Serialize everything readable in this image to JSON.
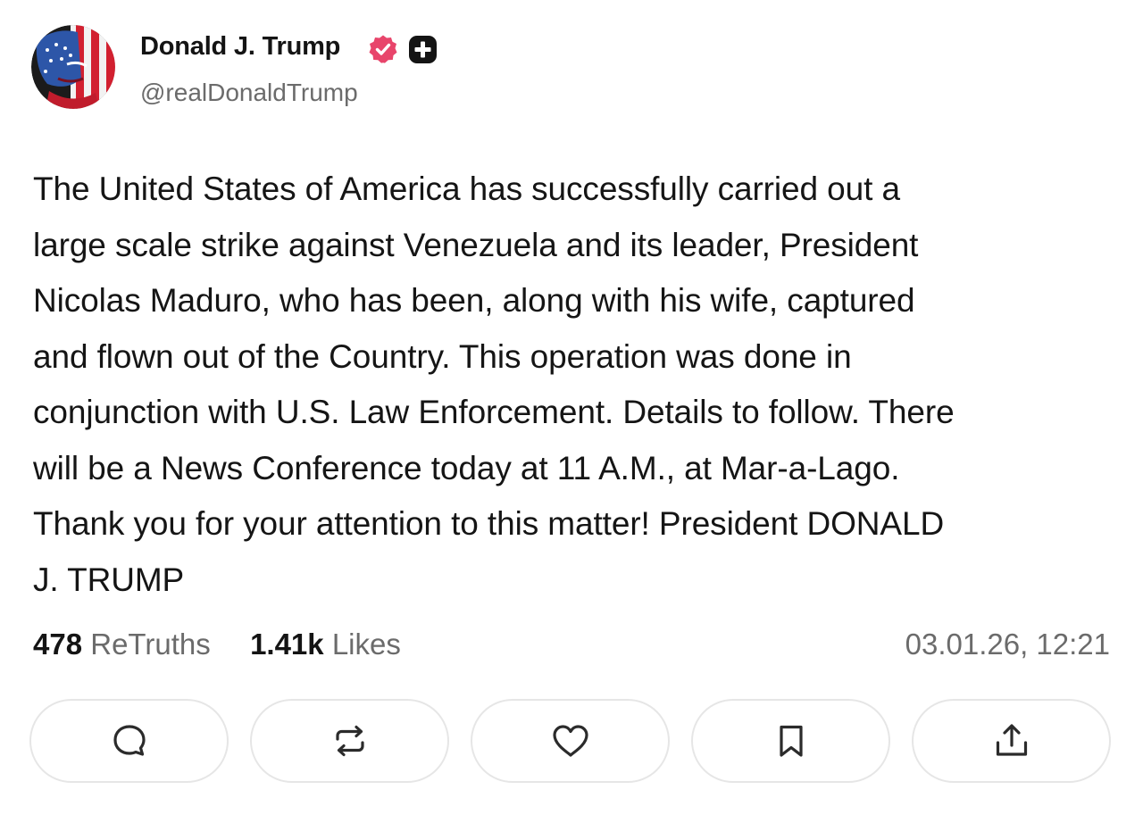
{
  "author": {
    "name": "Donald J. Trump",
    "handle": "@realDonaldTrump",
    "avatar_icon": "avatar-flag-portrait",
    "badges": [
      "verified-icon",
      "plus-badge-icon"
    ],
    "verified_color": "#e8456b"
  },
  "post": {
    "body": "The United States of America has successfully carried out a\nlarge scale strike against Venezuela and its leader, President\nNicolas Maduro, who has been, along with his wife, captured\nand flown out of the Country. This operation was done in\nconjunction with U.S. Law Enforcement. Details to follow. There\nwill be a News Conference today at 11 A.M., at Mar-a-Lago.\nThank you for your attention to this matter! President DONALD\nJ. TRUMP"
  },
  "stats": {
    "retruths_count": "478",
    "retruths_label": "ReTruths",
    "likes_count": "1.41k",
    "likes_label": "Likes",
    "timestamp": "03.01.26, 12:21"
  },
  "actions": [
    {
      "name": "reply",
      "icon": "comment-icon"
    },
    {
      "name": "retruth",
      "icon": "repost-icon"
    },
    {
      "name": "like",
      "icon": "heart-icon"
    },
    {
      "name": "bookmark",
      "icon": "bookmark-icon"
    },
    {
      "name": "share",
      "icon": "share-icon"
    }
  ],
  "colors": {
    "text": "#141414",
    "muted": "#6b6b6b",
    "button_border": "#e6e6e6",
    "icon": "#2b2b2b"
  }
}
